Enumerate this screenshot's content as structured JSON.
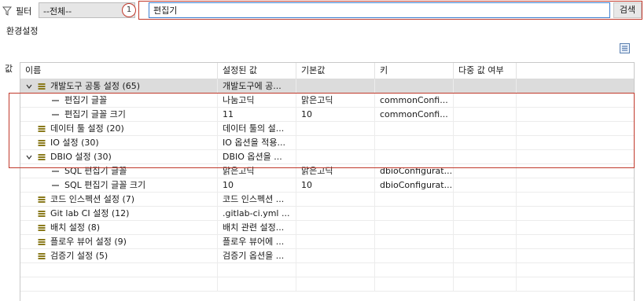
{
  "filter": {
    "label": "필터",
    "select_value": "--전체--",
    "marker": "1",
    "search_value": "편집기",
    "search_button": "검색"
  },
  "section": {
    "title": "환경설정",
    "side_label": "값"
  },
  "table": {
    "columns": [
      "이름",
      "설정된 값",
      "기본값",
      "키",
      "다중 값 여부"
    ],
    "rows": [
      {
        "level": 0,
        "type": "group",
        "expanded": true,
        "name": "개발도구 공통 설정 (65)",
        "value": "개발도구에 공...",
        "default": "",
        "key": "",
        "multi": "",
        "selected": true
      },
      {
        "level": 1,
        "type": "leaf",
        "name": "편집기 글꼴",
        "value": "나눔고딕",
        "default": "맑은고딕",
        "key": "commonConfi...",
        "multi": ""
      },
      {
        "level": 1,
        "type": "leaf",
        "name": "편집기 글꼴 크기",
        "value": "11",
        "default": "10",
        "key": "commonConfi...",
        "multi": ""
      },
      {
        "level": 0,
        "type": "group",
        "expanded": false,
        "name": "데이터 툴 설정 (20)",
        "value": "데이터 툴의 설...",
        "default": "",
        "key": "",
        "multi": ""
      },
      {
        "level": 0,
        "type": "group",
        "expanded": false,
        "name": "IO 설정 (30)",
        "value": "IO 옵션을 적용...",
        "default": "",
        "key": "",
        "multi": ""
      },
      {
        "level": 0,
        "type": "group",
        "expanded": true,
        "name": "DBIO 설정 (30)",
        "value": "DBIO 옵션을 ...",
        "default": "",
        "key": "",
        "multi": ""
      },
      {
        "level": 1,
        "type": "leaf",
        "name": "SQL 편집기 글꼴",
        "value": "맑은고딕",
        "default": "맑은고딕",
        "key": "dbioConfigurat...",
        "multi": ""
      },
      {
        "level": 1,
        "type": "leaf",
        "name": "SQL 편집기 글꼴 크기",
        "value": "10",
        "default": "10",
        "key": "dbioConfigurat...",
        "multi": ""
      },
      {
        "level": 0,
        "type": "group",
        "expanded": false,
        "name": "코드 인스펙션 설정 (7)",
        "value": "코드 인스펙션 ...",
        "default": "",
        "key": "",
        "multi": ""
      },
      {
        "level": 0,
        "type": "group",
        "expanded": false,
        "name": "Git lab CI 설정 (12)",
        "value": ".gitlab-ci.yml ...",
        "default": "",
        "key": "",
        "multi": ""
      },
      {
        "level": 0,
        "type": "group",
        "expanded": false,
        "name": "배치 설정 (8)",
        "value": "배치 관련 설정...",
        "default": "",
        "key": "",
        "multi": ""
      },
      {
        "level": 0,
        "type": "group",
        "expanded": false,
        "name": "플로우 뷰어 설정 (9)",
        "value": "플로우 뷰어에 ...",
        "default": "",
        "key": "",
        "multi": ""
      },
      {
        "level": 0,
        "type": "group",
        "expanded": false,
        "name": "검증기 설정 (5)",
        "value": "검증기 옵션을 ...",
        "default": "",
        "key": "",
        "multi": ""
      },
      {
        "level": 0,
        "type": "empty",
        "name": "",
        "value": "",
        "default": "",
        "key": "",
        "multi": ""
      },
      {
        "level": 0,
        "type": "empty",
        "name": "",
        "value": "",
        "default": "",
        "key": "",
        "multi": ""
      }
    ]
  },
  "colors": {
    "annotation": "#c0392b",
    "selected_row": "#dcdcdc",
    "category_icon": "#8a7a1c",
    "focus_border": "#3c7fd0"
  },
  "icons": {
    "filter": "filter-icon",
    "category": "category-icon",
    "leaf": "leaf-icon",
    "collapse_all": "collapse-all-icon"
  }
}
